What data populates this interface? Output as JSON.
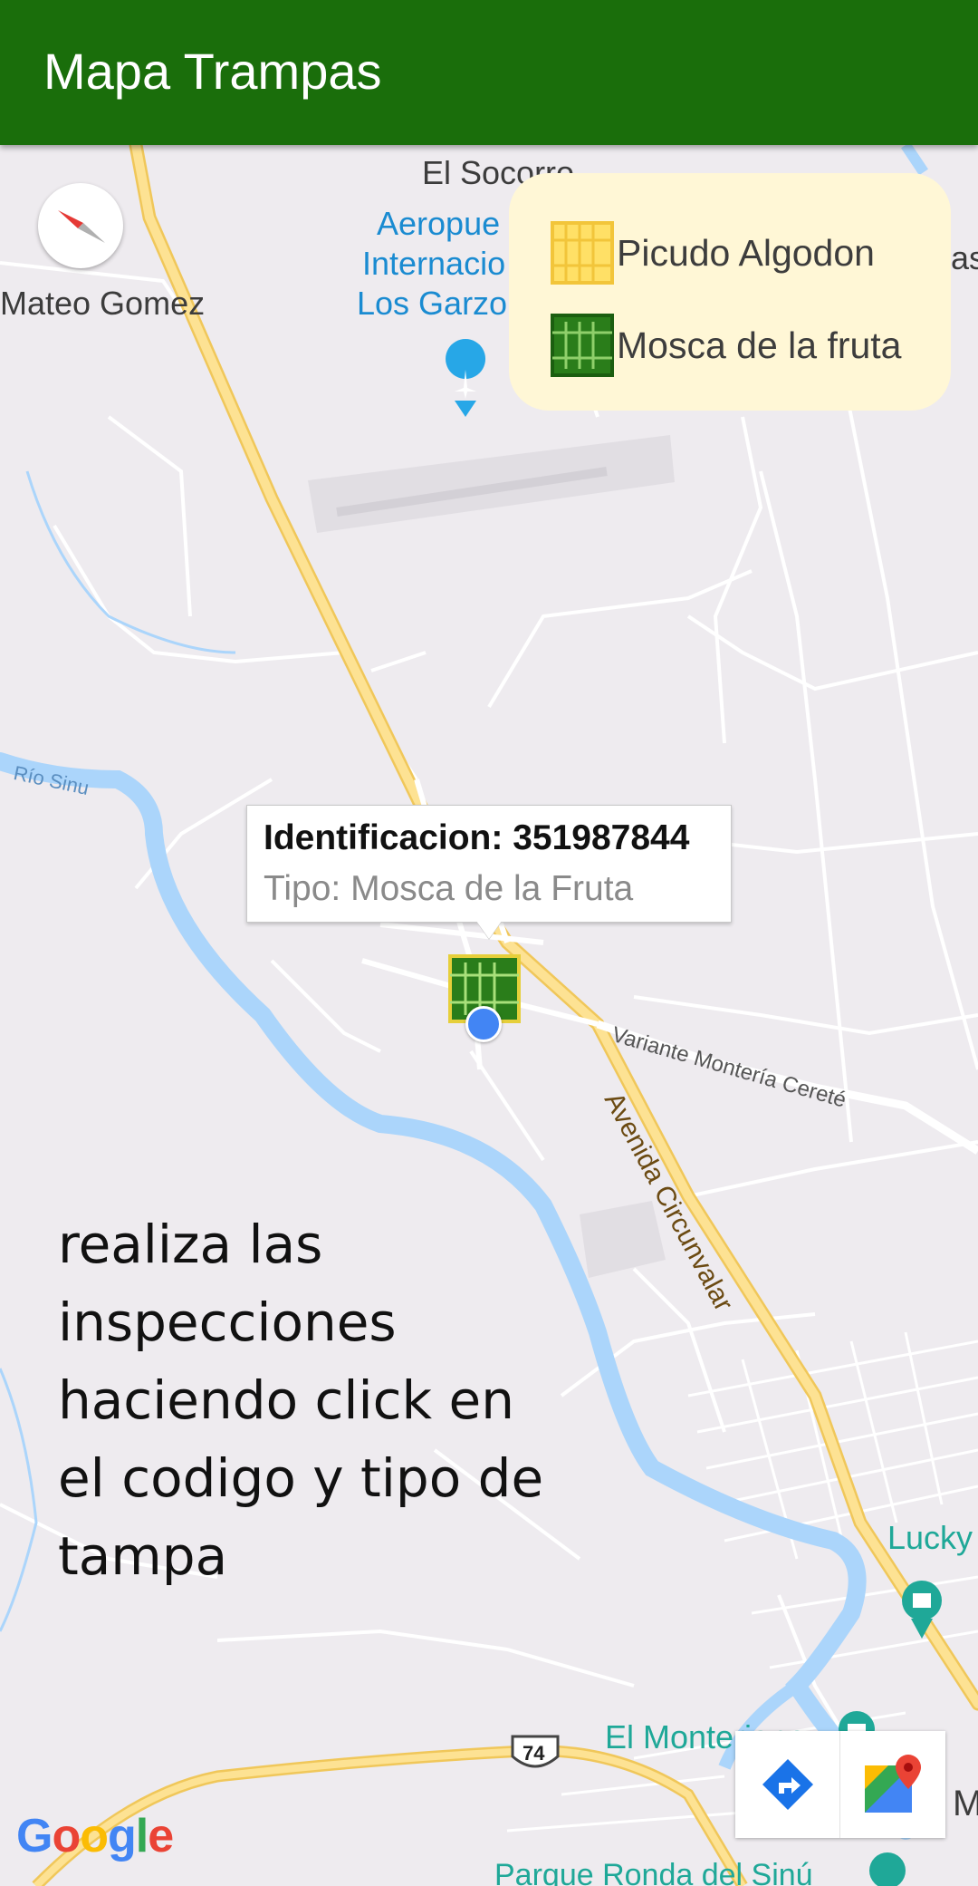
{
  "app": {
    "title": "Mapa Trampas",
    "accent_color": "#1a6e0b"
  },
  "map": {
    "places": {
      "socorro": "El Socorro",
      "airport_line1": "Aeropue",
      "airport_line2": "Internacio",
      "airport_line3": "Los Garzo",
      "mateo_gomez": "Mateo Gomez",
      "right_edge": "as",
      "rio_sinu": "Río Sinu",
      "variante": "Variante Montería Cereté",
      "avenida": "Avenida Circunvalar",
      "lucky": "Lucky",
      "monteriano": "El Monteriano",
      "parque": "Parque Ronda del Sinú",
      "route_74": "74",
      "edge_m": "M"
    },
    "icons": [
      "compass-icon",
      "airport-icon",
      "store-icon",
      "camera-icon"
    ]
  },
  "legend": {
    "items": [
      {
        "label": "Picudo Algodon",
        "icon": "trap-yellow-icon",
        "color": "#ffe066"
      },
      {
        "label": "Mosca de la fruta",
        "icon": "trap-green-icon",
        "color": "#2a7d1a"
      }
    ]
  },
  "info_window": {
    "identification": "Identificacion: 351987844",
    "type": "Tipo: Mosca de la Fruta"
  },
  "hint_text": "realiza las inspecciones haciendo click en el codigo y tipo de tampa",
  "toolbar": {
    "directions_icon": "directions-icon",
    "gmaps_icon": "google-maps-icon"
  },
  "google_logo": "Google"
}
